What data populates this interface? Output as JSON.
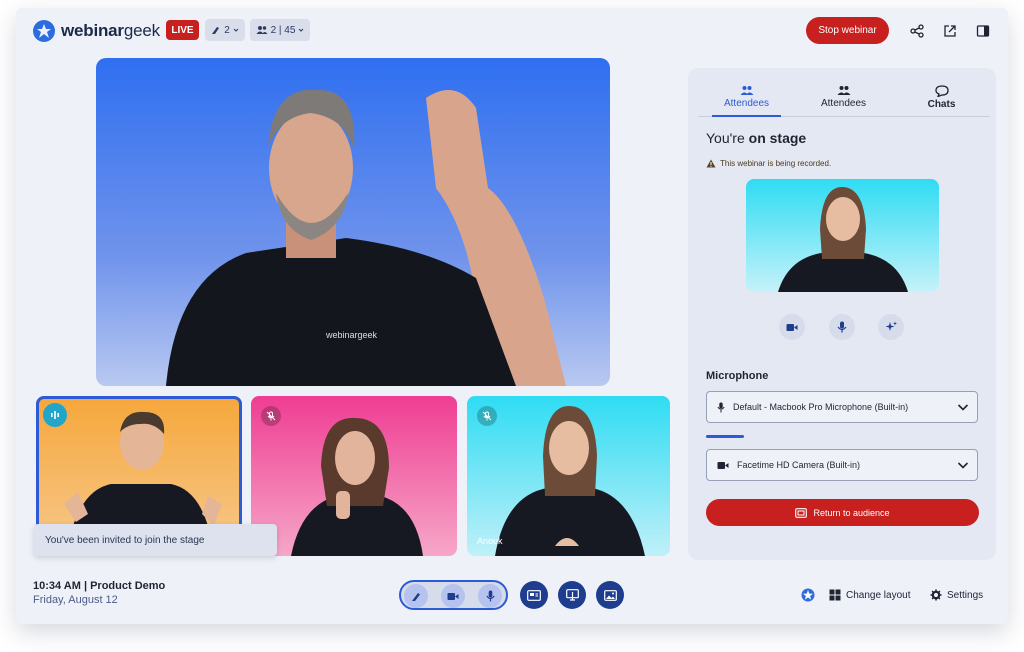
{
  "header": {
    "brand_bold": "webinar",
    "brand_light": "geek",
    "live_label": "LIVE",
    "speakers_count": "2",
    "attendees_count": "2 | 45",
    "stop_label": "Stop webinar"
  },
  "stage": {
    "thumb3_name": "Anouk",
    "toast_text": "You've been invited to join the stage"
  },
  "panel": {
    "tabs": [
      {
        "label": "Attendees"
      },
      {
        "label": "Attendees"
      },
      {
        "label": "Chats"
      }
    ],
    "title_prefix": "You're ",
    "title_bold": "on stage",
    "recording_note": "This webinar is being recorded.",
    "microphone_label": "Microphone",
    "microphone_value": "Default - Macbook Pro Microphone (Built-in)",
    "camera_value": "Facetime HD Camera (Built-in)",
    "return_label": "Return to audience",
    "mic_level": 0.14
  },
  "footer": {
    "time": "10:34 AM | Product Demo",
    "date": "Friday, August 12",
    "change_layout_label": "Change layout",
    "settings_label": "Settings"
  },
  "colors": {
    "accent": "#2d5bd6",
    "live": "#c81f1f",
    "control_dark": "#1e3d8f"
  }
}
